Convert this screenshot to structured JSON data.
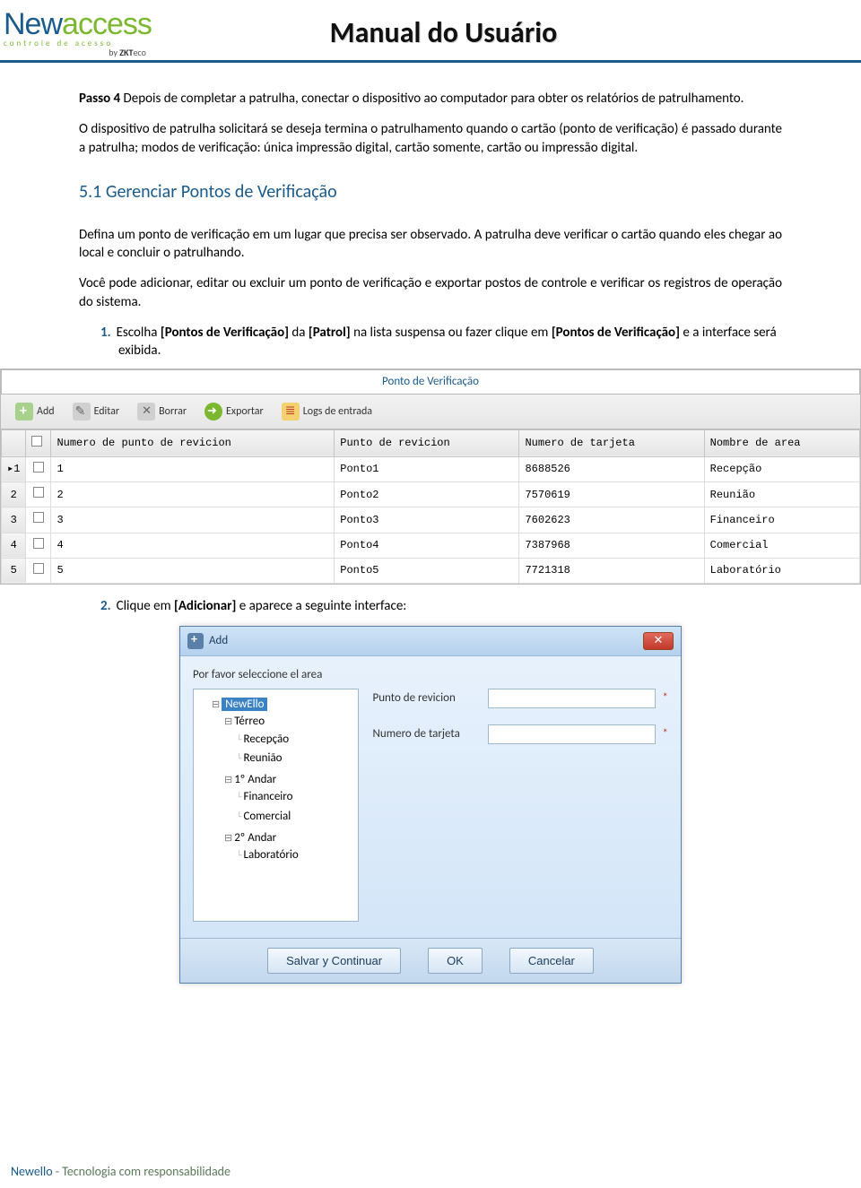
{
  "header": {
    "logo_new": "New",
    "logo_access": "access",
    "logo_sub": "controle de acesso",
    "logo_by_prefix": "by ",
    "logo_by_brand": "ZKT",
    "logo_by_suffix": "eco",
    "title": "Manual do Usuário"
  },
  "body": {
    "passo_label": "Passo 4",
    "passo_text": " Depois de completar a patrulha, conectar o dispositivo ao computador para obter os relatórios de patrulhamento.",
    "para2": "O dispositivo de patrulha solicitará se deseja termina o patrulhamento quando o cartão (ponto de verificação) é passado durante a patrulha; modos de verificação: única impressão digital, cartão somente, cartão ou impressão digital.",
    "h2": "5.1 Gerenciar Pontos de Verificação",
    "para3": "Defina um ponto de verificação em um lugar que precisa ser observado. A patrulha deve verificar o cartão quando eles chegar ao local e concluir o patrulhando.",
    "para4": "Você pode adicionar, editar ou excluir um ponto de verificação e exportar postos de controle e verificar os registros de operação do sistema.",
    "item1_num": "1.",
    "item1_a": "Escolha ",
    "item1_b": "[Pontos de Verificação]",
    "item1_c": " da ",
    "item1_d": "[Patrol]",
    "item1_e": " na lista suspensa ou fazer clique em ",
    "item1_f": "[Pontos de Verificação]",
    "item1_g": " e a interface será exibida.",
    "item2_num": "2.",
    "item2_a": "Clique em ",
    "item2_b": "[Adicionar]",
    "item2_c": " e aparece a seguinte interface:"
  },
  "win1": {
    "title": "Ponto de Verificação",
    "toolbar": {
      "add": "Add",
      "editar": "Editar",
      "borrar": "Borrar",
      "exportar": "Exportar",
      "logs": "Logs de entrada"
    },
    "headers": [
      "",
      "",
      "Numero de punto de revicion",
      "Punto de revicion",
      "Numero de tarjeta",
      "Nombre de area"
    ],
    "rows": [
      {
        "idx": "▸1",
        "num": "1",
        "punto": "Ponto1",
        "tarjeta": "8688526",
        "area": "Recepção"
      },
      {
        "idx": "2",
        "num": "2",
        "punto": "Ponto2",
        "tarjeta": "7570619",
        "area": "Reunião"
      },
      {
        "idx": "3",
        "num": "3",
        "punto": "Ponto3",
        "tarjeta": "7602623",
        "area": "Financeiro"
      },
      {
        "idx": "4",
        "num": "4",
        "punto": "Ponto4",
        "tarjeta": "7387968",
        "area": "Comercial"
      },
      {
        "idx": "5",
        "num": "5",
        "punto": "Ponto5",
        "tarjeta": "7721318",
        "area": "Laboratório"
      }
    ]
  },
  "dlg": {
    "title": "Add",
    "left_label": "Por favor seleccione el area",
    "tree": {
      "root": "NewEllo",
      "nodes": [
        {
          "label": "Térreo",
          "children": [
            "Recepção",
            "Reunião"
          ]
        },
        {
          "label": "1º Andar",
          "children": [
            "Financeiro",
            "Comercial"
          ]
        },
        {
          "label": "2º Andar",
          "children": [
            "Laboratório"
          ]
        }
      ]
    },
    "field1": "Punto de revicion",
    "field2": "Numero de tarjeta",
    "btn_save": "Salvar y Continuar",
    "btn_ok": "OK",
    "btn_cancel": "Cancelar"
  },
  "footer": {
    "brand": "Newello",
    "rest": " - Tecnologia com responsabilidade"
  }
}
